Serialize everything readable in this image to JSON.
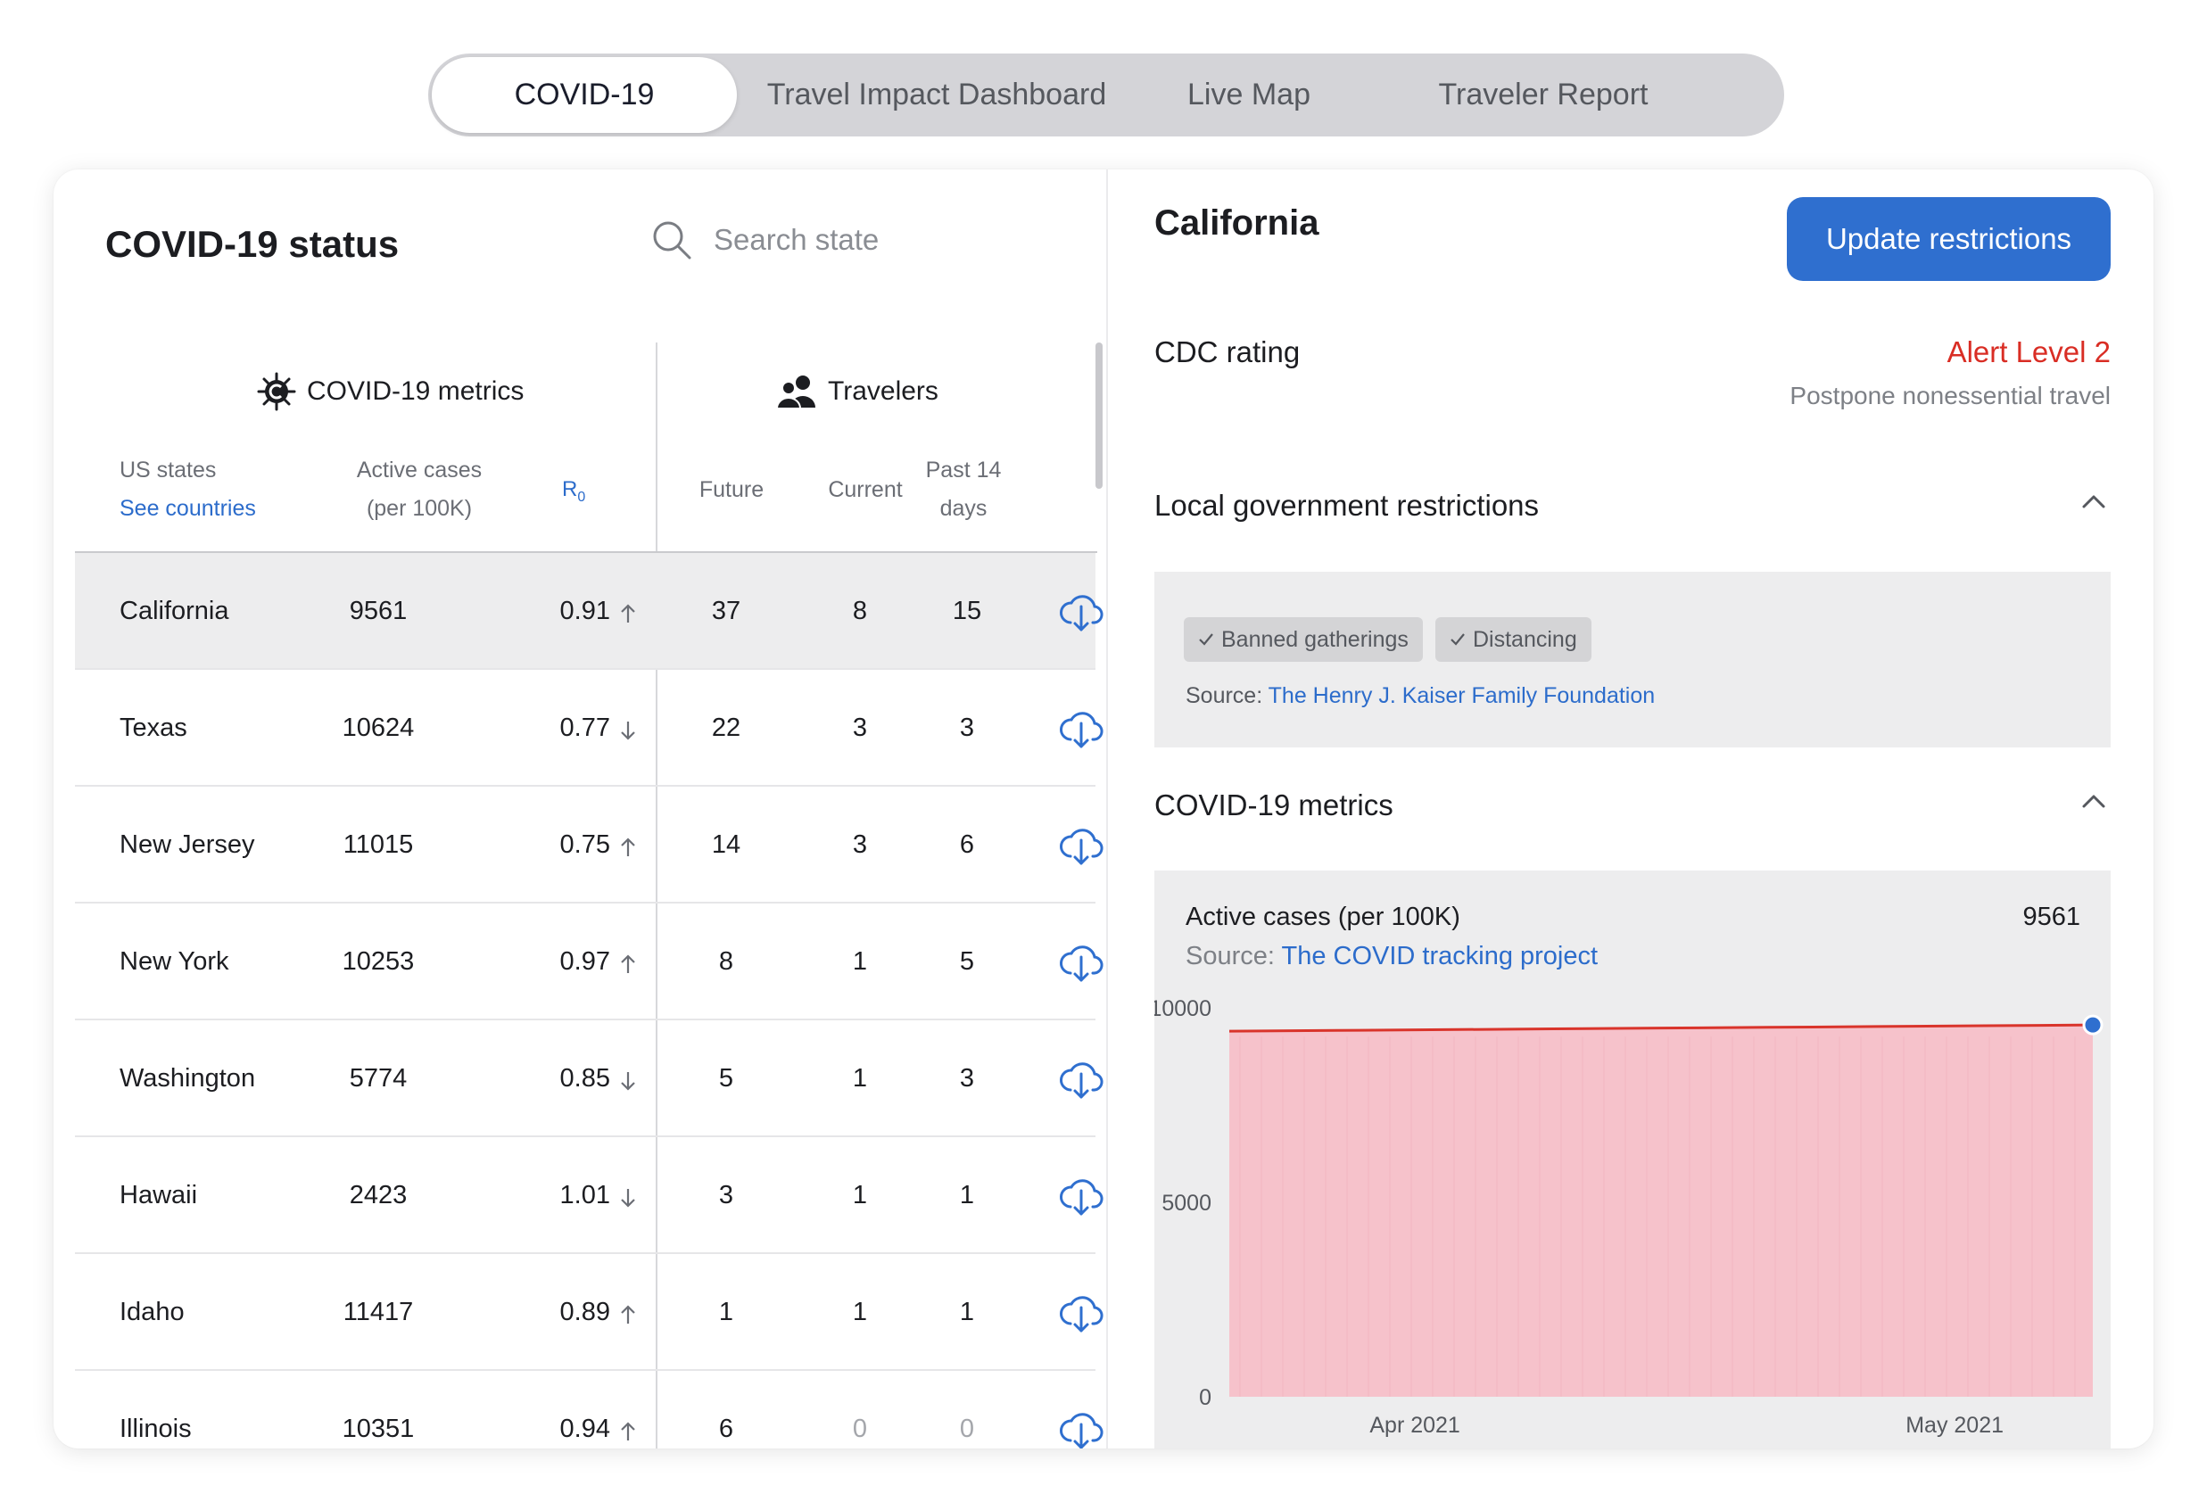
{
  "tabs": [
    {
      "label": "COVID-19",
      "active": true
    },
    {
      "label": "Travel Impact Dashboard",
      "active": false
    },
    {
      "label": "Live Map",
      "active": false
    },
    {
      "label": "Traveler Report",
      "active": false
    }
  ],
  "left": {
    "title": "COVID-19 status",
    "search_placeholder": "Search state",
    "group_covid": "COVID-19 metrics",
    "group_travelers": "Travelers",
    "col_us_states": "US states",
    "col_see_countries": "See countries",
    "col_active_1": "Active cases",
    "col_active_2": "(per 100K)",
    "col_r0": "R",
    "col_r0_sub": "0",
    "col_future": "Future",
    "col_current": "Current",
    "col_past_1": "Past 14",
    "col_past_2": "days",
    "rows": [
      {
        "state": "California",
        "cases": "9561",
        "r0": "0.91",
        "trend": "up",
        "future": "37",
        "current": "8",
        "past": "15"
      },
      {
        "state": "Texas",
        "cases": "10624",
        "r0": "0.77",
        "trend": "down",
        "future": "22",
        "current": "3",
        "past": "3"
      },
      {
        "state": "New Jersey",
        "cases": "11015",
        "r0": "0.75",
        "trend": "up",
        "future": "14",
        "current": "3",
        "past": "6"
      },
      {
        "state": "New York",
        "cases": "10253",
        "r0": "0.97",
        "trend": "up",
        "future": "8",
        "current": "1",
        "past": "5"
      },
      {
        "state": "Washington",
        "cases": "5774",
        "r0": "0.85",
        "trend": "down",
        "future": "5",
        "current": "1",
        "past": "3"
      },
      {
        "state": "Hawaii",
        "cases": "2423",
        "r0": "1.01",
        "trend": "down",
        "future": "3",
        "current": "1",
        "past": "1"
      },
      {
        "state": "Idaho",
        "cases": "11417",
        "r0": "0.89",
        "trend": "up",
        "future": "1",
        "current": "1",
        "past": "1"
      },
      {
        "state": "Illinois",
        "cases": "10351",
        "r0": "0.94",
        "trend": "up",
        "future": "6",
        "current": "0",
        "past": "0"
      }
    ]
  },
  "right": {
    "state": "California",
    "update_button": "Update restrictions",
    "cdc_label": "CDC rating",
    "cdc_level": "Alert Level 2",
    "cdc_sub": "Postpone nonessential travel",
    "restrictions_title": "Local government restrictions",
    "chips": [
      "Banned gatherings",
      "Distancing"
    ],
    "restrictions_source_prefix": "Source: ",
    "restrictions_source_link": "The Henry J. Kaiser Family Foundation",
    "metrics_title": "COVID-19 metrics",
    "metric_name": "Active cases (per 100K)",
    "metric_value": "9561",
    "metric_source_prefix": "Source: ",
    "metric_source_link": "The COVID tracking project"
  },
  "chart_data": {
    "type": "area",
    "title": "",
    "series": [
      {
        "values": [
          9400,
          9420,
          9440,
          9460,
          9480,
          9500,
          9520,
          9540,
          9561
        ]
      }
    ],
    "x_tick_labels": [
      "Apr 2021",
      "May 2021"
    ],
    "y_ticks": [
      0,
      5000,
      10000
    ],
    "ylim": [
      0,
      10000
    ],
    "grid": false,
    "line_color": "#d9342b",
    "fill_color": "#f6c2cb",
    "marker_color": "#2f6fcf"
  },
  "colors": {
    "accent": "#2f6fcf",
    "link": "#2c6ccb",
    "alert": "#d92d24"
  },
  "icons": {
    "search": "search-icon",
    "virus": "virus-icon",
    "people": "people-icon",
    "download": "cloud-download-icon",
    "chevron": "chevron-up-icon",
    "check": "check-icon"
  }
}
